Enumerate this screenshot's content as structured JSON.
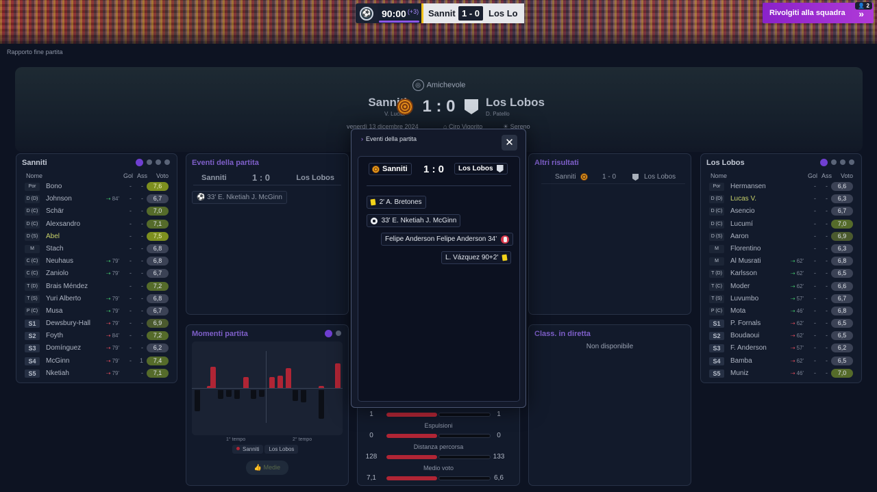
{
  "scorebug": {
    "minute": "90:00",
    "added": "(+3)",
    "home": "Sannit",
    "score": "1 - 0",
    "away": "Los Lo"
  },
  "team_button": {
    "label": "Rivolgiti alla squadra",
    "users": "2"
  },
  "breadcrumb": "Rapporto fine partita",
  "hero": {
    "competition": "Amichevole",
    "home": "Sanniti",
    "home_coach": "V. Lucidi",
    "score": "1 : 0",
    "away": "Los Lobos",
    "away_coach": "D. Patello",
    "date": "venerdì 13 dicembre 2024",
    "venue": "Ciro Vigorito",
    "weather": "Sereno"
  },
  "home_panel": {
    "title": "Sanniti",
    "headers": {
      "name": "Nome",
      "gol": "Gol",
      "ass": "Ass",
      "voto": "Voto"
    },
    "players": [
      {
        "pos": "Por",
        "name": "Bono",
        "sw": "",
        "gol": "-",
        "ass": "-",
        "voto": "7,6"
      },
      {
        "pos": "D (D)",
        "name": "Johnson",
        "sw": "84'",
        "gol": "-",
        "ass": "-",
        "voto": "6,7"
      },
      {
        "pos": "D (C)",
        "name": "Schär",
        "sw": "",
        "gol": "-",
        "ass": "-",
        "voto": "7,0"
      },
      {
        "pos": "D (C)",
        "name": "Alexsandro",
        "sw": "",
        "gol": "-",
        "ass": "-",
        "voto": "7,1"
      },
      {
        "pos": "D (S)",
        "name": "Abel",
        "sw": "",
        "gol": "-",
        "ass": "-",
        "voto": "7,5"
      },
      {
        "pos": "M",
        "name": "Stach",
        "sw": "",
        "gol": "-",
        "ass": "-",
        "voto": "6,8"
      },
      {
        "pos": "C (C)",
        "name": "Neuhaus",
        "sw": "79'",
        "gol": "-",
        "ass": "-",
        "voto": "6,8"
      },
      {
        "pos": "C (C)",
        "name": "Zaniolo",
        "sw": "79'",
        "gol": "-",
        "ass": "-",
        "voto": "6,7"
      },
      {
        "pos": "T (D)",
        "name": "Brais Méndez",
        "sw": "",
        "gol": "-",
        "ass": "-",
        "voto": "7,2"
      },
      {
        "pos": "T (S)",
        "name": "Yuri Alberto",
        "sw": "79'",
        "gol": "-",
        "ass": "-",
        "voto": "6,8"
      },
      {
        "pos": "P (C)",
        "name": "Musa",
        "sw": "79'",
        "gol": "-",
        "ass": "-",
        "voto": "6,7"
      },
      {
        "pos": "S1",
        "name": "Dewsbury-Hall",
        "sw": "79'",
        "gol": "-",
        "ass": "-",
        "voto": "6,9"
      },
      {
        "pos": "S2",
        "name": "Foyth",
        "sw": "84'",
        "gol": "-",
        "ass": "-",
        "voto": "7,2"
      },
      {
        "pos": "S3",
        "name": "Domínguez",
        "sw": "79'",
        "gol": "-",
        "ass": "-",
        "voto": "6,2"
      },
      {
        "pos": "S4",
        "name": "McGinn",
        "sw": "79'",
        "gol": "-",
        "ass": "1",
        "voto": "7,4"
      },
      {
        "pos": "S5",
        "name": "Nketiah",
        "sw": "79'",
        "gol": "",
        "ass": "-",
        "voto": "7,1"
      }
    ]
  },
  "away_panel": {
    "title": "Los Lobos",
    "headers": {
      "name": "Nome",
      "gol": "Gol",
      "ass": "Ass",
      "voto": "Voto"
    },
    "players": [
      {
        "pos": "Por",
        "name": "Hermansen",
        "sw": "",
        "gol": "-",
        "ass": "-",
        "voto": "6,6"
      },
      {
        "pos": "D (D)",
        "name": "Lucas V.",
        "sw": "",
        "gol": "-",
        "ass": "-",
        "voto": "6,3"
      },
      {
        "pos": "D (C)",
        "name": "Asencio",
        "sw": "",
        "gol": "-",
        "ass": "-",
        "voto": "6,7"
      },
      {
        "pos": "D (C)",
        "name": "Lucumí",
        "sw": "",
        "gol": "-",
        "ass": "-",
        "voto": "7,0"
      },
      {
        "pos": "D (S)",
        "name": "Aaron",
        "sw": "",
        "gol": "-",
        "ass": "-",
        "voto": "6,9"
      },
      {
        "pos": "M",
        "name": "Florentino",
        "sw": "",
        "gol": "-",
        "ass": "-",
        "voto": "6,3"
      },
      {
        "pos": "M",
        "name": "Al Musrati",
        "sw": "62'",
        "gol": "-",
        "ass": "-",
        "voto": "6,8"
      },
      {
        "pos": "T (D)",
        "name": "Karlsson",
        "sw": "62'",
        "gol": "-",
        "ass": "-",
        "voto": "6,5"
      },
      {
        "pos": "T (C)",
        "name": "Moder",
        "sw": "62'",
        "gol": "-",
        "ass": "-",
        "voto": "6,6"
      },
      {
        "pos": "T (S)",
        "name": "Luvumbo",
        "sw": "57'",
        "gol": "-",
        "ass": "-",
        "voto": "6,7"
      },
      {
        "pos": "P (C)",
        "name": "Mota",
        "sw": "46'",
        "gol": "-",
        "ass": "-",
        "voto": "6,8"
      },
      {
        "pos": "S1",
        "name": "P. Fornals",
        "sw": "62'",
        "gol": "-",
        "ass": "-",
        "voto": "6,5"
      },
      {
        "pos": "S2",
        "name": "Boudaoui",
        "sw": "62'",
        "gol": "-",
        "ass": "-",
        "voto": "6,5"
      },
      {
        "pos": "S3",
        "name": "F. Anderson",
        "sw": "57'",
        "gol": "-",
        "ass": "-",
        "voto": "6,2"
      },
      {
        "pos": "S4",
        "name": "Bamba",
        "sw": "62'",
        "gol": "-",
        "ass": "-",
        "voto": "6,5"
      },
      {
        "pos": "S5",
        "name": "Muniz",
        "sw": "46'",
        "gol": "-",
        "ass": "-",
        "voto": "7,0"
      }
    ]
  },
  "events_panel": {
    "title": "Eventi della partita",
    "home": "Sanniti",
    "score": "1 : 0",
    "away": "Los Lobos",
    "event": "33' E. Nketiah J. McGinn"
  },
  "moments_panel": {
    "title": "Momenti partita",
    "first_half": "1° tempo",
    "second_half": "2° tempo",
    "legend_home": "Sanniti",
    "legend_away": "Los Lobos",
    "button": "Medie"
  },
  "other_results": {
    "title": "Altri risultati",
    "home": "Sanniti",
    "score": "1 - 0",
    "away": "Los Lobos"
  },
  "live_table": {
    "title": "Class. in diretta",
    "empty": "Non disponibile"
  },
  "stats": [
    {
      "home": "1",
      "away": "1",
      "label": "Espulsioni"
    },
    {
      "home": "0",
      "away": "0",
      "label": "Distanza percorsa"
    },
    {
      "home": "128",
      "away": "133",
      "label": "Medio voto"
    },
    {
      "home": "7,1",
      "away": "6,6",
      "label": ""
    }
  ],
  "modal": {
    "title": "Eventi della partita",
    "home": "Sanniti",
    "score": "1 : 0",
    "away": "Los Lobos",
    "events": [
      {
        "text": "2' A. Bretones"
      },
      {
        "text": "33' E. Nketiah J. McGinn"
      },
      {
        "text": "Felipe Anderson Felipe Anderson 34'"
      },
      {
        "text": "L. Vázquez 90+2'"
      }
    ]
  },
  "moments_chart": {
    "home_up": [
      0.05,
      0.6,
      0.3,
      0.3,
      0.35,
      0.55,
      0.05,
      0.7
    ],
    "away_down": [
      0.6,
      0.25,
      0.2,
      0.25,
      0.25,
      0.2,
      0.3,
      0.35,
      0.8
    ]
  }
}
